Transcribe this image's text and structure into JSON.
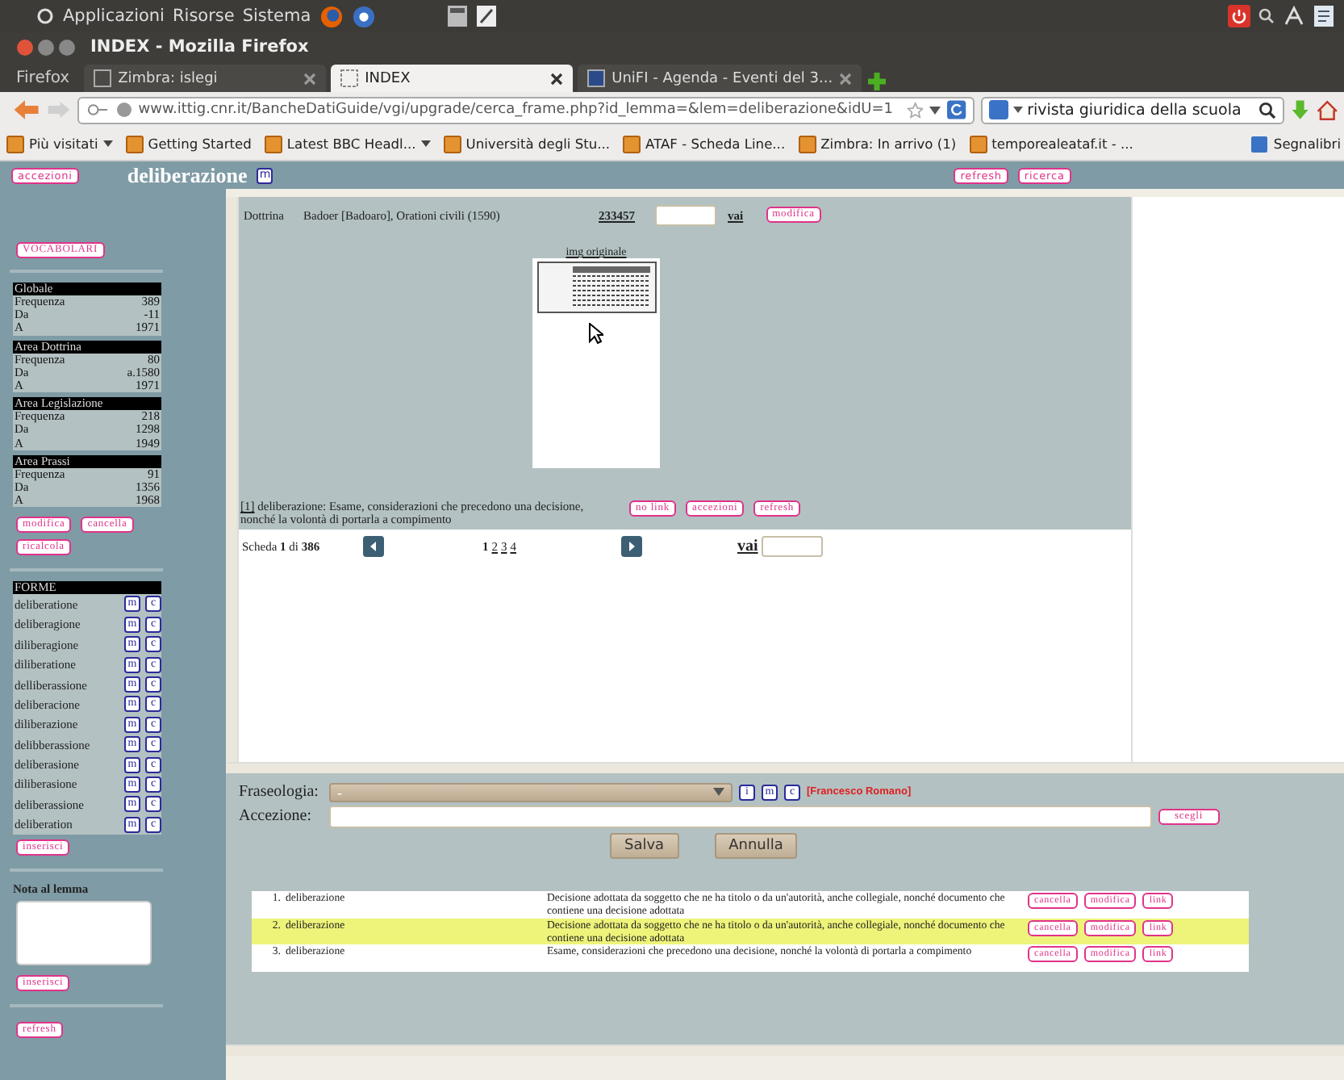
{
  "os_panel": {
    "menus": [
      "Applicazioni",
      "Risorse",
      "Sistema"
    ]
  },
  "window": {
    "title": "INDEX - Mozilla Firefox"
  },
  "browser": {
    "app_menu": "Firefox",
    "tabs": [
      {
        "label": "Zimbra: islegi",
        "selected": false
      },
      {
        "label": "INDEX",
        "selected": true
      },
      {
        "label": "UniFI - Agenda - Eventi del 3...",
        "selected": false
      }
    ],
    "url": "www.ittig.cnr.it/BancheDatiGuide/vgi/upgrade/cerca_frame.php?id_lemma=&lem=deliberazione&idU=1",
    "search": "rivista giuridica della scuola",
    "bookmarks": [
      {
        "label": "Più visitati",
        "has_menu": true
      },
      {
        "label": "Getting Started",
        "has_menu": false
      },
      {
        "label": "Latest BBC Headl...",
        "has_menu": true
      },
      {
        "label": "Università degli Stu...",
        "has_menu": false
      },
      {
        "label": "ATAF - Scheda Line...",
        "has_menu": false
      },
      {
        "label": "Zimbra: In arrivo (1)",
        "has_menu": false
      },
      {
        "label": "temporealeataf.it - ...",
        "has_menu": false
      }
    ],
    "bookmarks_menu": "Segnalibri"
  },
  "header": {
    "left_button": "accezioni",
    "lemma": "deliberazione",
    "lemma_icon": "m",
    "right_buttons": [
      "refresh",
      "ricerca"
    ]
  },
  "sidebar": {
    "vocab_button": "VOCABOLARI",
    "stats": [
      {
        "title": "Globale",
        "rows": [
          {
            "label": "Frequenza",
            "value": "389"
          },
          {
            "label": "Da",
            "value": "-11"
          },
          {
            "label": "A",
            "value": "1971"
          }
        ]
      },
      {
        "title": "Area Dottrina",
        "rows": [
          {
            "label": "Frequenza",
            "value": "80"
          },
          {
            "label": "Da",
            "value": "a.1580"
          },
          {
            "label": "A",
            "value": "1971"
          }
        ]
      },
      {
        "title": "Area Legislazione",
        "rows": [
          {
            "label": "Frequenza",
            "value": "218"
          },
          {
            "label": "Da",
            "value": "1298"
          },
          {
            "label": "A",
            "value": "1949"
          }
        ]
      },
      {
        "title": "Area Prassi",
        "rows": [
          {
            "label": "Frequenza",
            "value": "91"
          },
          {
            "label": "Da",
            "value": "1356"
          },
          {
            "label": "A",
            "value": "1968"
          }
        ]
      }
    ],
    "stat_buttons": [
      "modifica",
      "cancella",
      "ricalcola"
    ],
    "forms_title": "FORME",
    "forms": [
      {
        "name": "deliberatione",
        "actions": [
          "m",
          "c"
        ]
      },
      {
        "name": "deliberagione",
        "actions": [
          "m",
          "c"
        ]
      },
      {
        "name": "diliberagione",
        "actions": [
          "m",
          "c"
        ]
      },
      {
        "name": "diliberatione",
        "actions": [
          "m",
          "c"
        ]
      },
      {
        "name": "delliberassione",
        "actions": [
          "m",
          "c"
        ]
      },
      {
        "name": "deliberacione",
        "actions": [
          "m",
          "c"
        ]
      },
      {
        "name": "diliberazione",
        "actions": [
          "m",
          "c"
        ]
      },
      {
        "name": "delibberassione",
        "actions": [
          "m",
          "c"
        ]
      },
      {
        "name": "deliberasione",
        "actions": [
          "m",
          "c"
        ]
      },
      {
        "name": "diliberasione",
        "actions": [
          "m",
          "c"
        ]
      },
      {
        "name": "deliberassione",
        "actions": [
          "m",
          "c"
        ]
      },
      {
        "name": "deliberation",
        "actions": [
          "m",
          "c"
        ]
      }
    ],
    "forms_button": "inserisci",
    "note_label": "Nota al lemma",
    "note_button": "inserisci",
    "refresh_button": "refresh"
  },
  "record": {
    "source": "Dottrina",
    "citation": "Badoer [Badoaro], Orationi civili (1590)",
    "id": "233457",
    "go": "vai",
    "edit": "modifica",
    "image_caption": "img originale",
    "note_ref": "[1]",
    "note_text": "deliberazione: Esame, considerazioni che precedono una decisione, nonché la volontà di portarla a compimento",
    "note_buttons": [
      "no link",
      "accezioni",
      "refresh"
    ]
  },
  "pager": {
    "summary": "Scheda **1** di **386**",
    "pages": [
      {
        "label": "1",
        "selected": true
      },
      {
        "label": "2",
        "selected": false
      },
      {
        "label": "3",
        "selected": false
      },
      {
        "label": "4",
        "selected": false
      }
    ],
    "go": "vai"
  },
  "editor": {
    "phrase_label": "Fraseologia:",
    "phrase_value": "-",
    "phrase_icons": [
      "i",
      "m",
      "c"
    ],
    "author": "[Francesco Romano]",
    "sense_label": "Accezione:",
    "choose_button": "scegli",
    "save_button": "Salva",
    "cancel_button": "Annulla"
  },
  "senses": {
    "rows": [
      {
        "number": "1.",
        "term": "deliberazione",
        "definition": "Decisione adottata da soggetto che ne ha titolo o da un'autorità, anche collegiale, nonché documento che contiene una decisione adottata",
        "selected": false,
        "actions": [
          "cancella",
          "modifica",
          "link"
        ]
      },
      {
        "number": "2.",
        "term": "deliberazione",
        "definition": "Decisione adottata da soggetto che ne ha titolo o da un'autorità, anche collegiale, nonché documento che contiene una decisione adottata",
        "selected": true,
        "actions": [
          "cancella",
          "modifica",
          "link"
        ]
      },
      {
        "number": "3.",
        "term": "deliberazione",
        "definition": "Esame, considerazioni che precedono una decisione, nonché la volontà di portarla a compimento",
        "selected": false,
        "actions": [
          "cancella",
          "modifica",
          "link"
        ]
      }
    ]
  }
}
